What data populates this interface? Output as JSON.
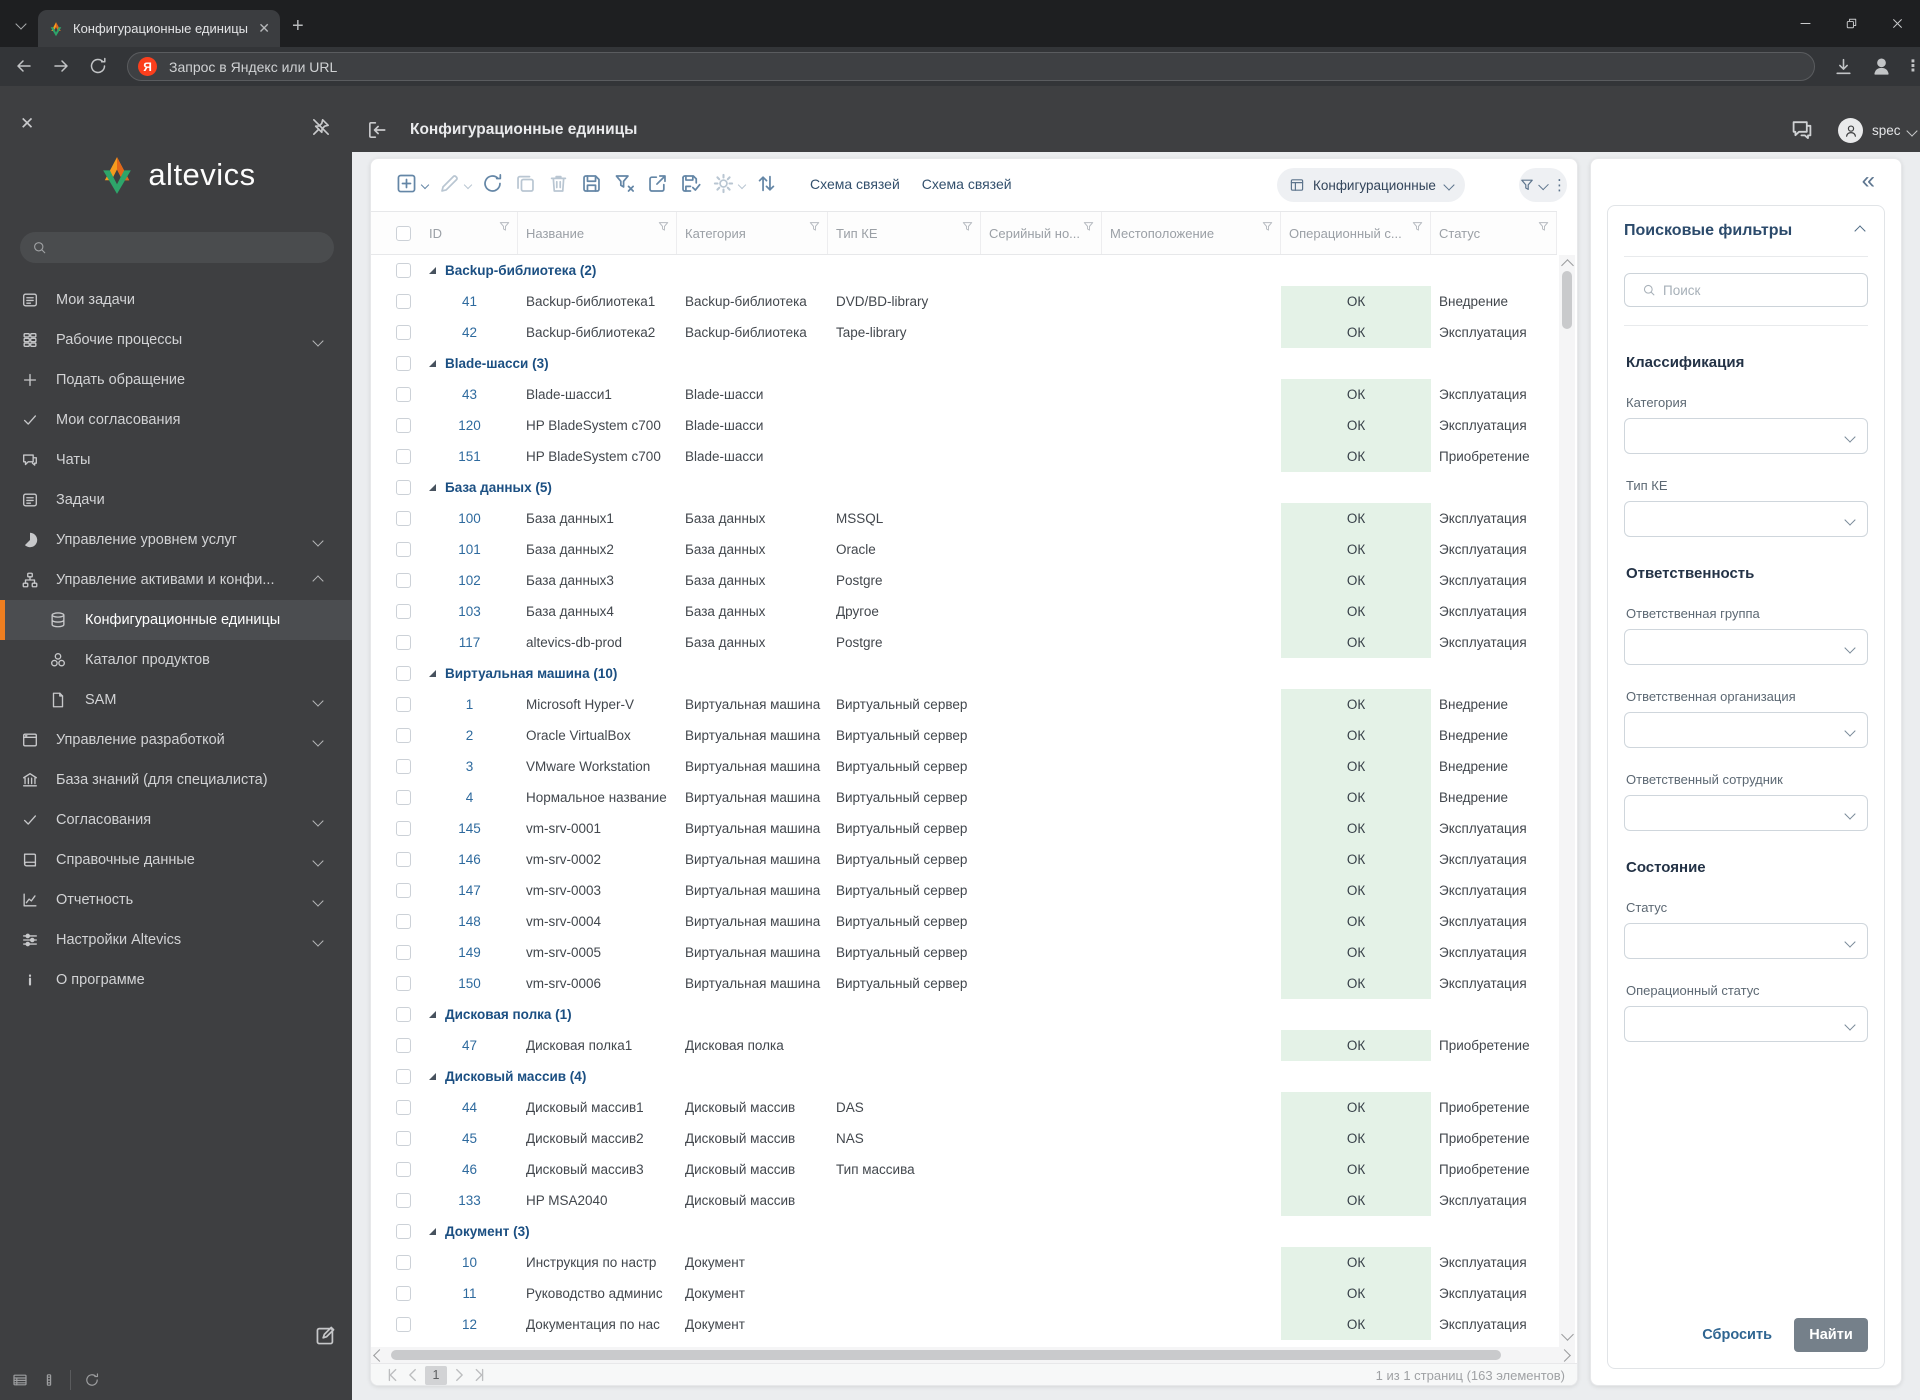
{
  "browser": {
    "tab_title": "Конфигурационные единицы",
    "url_placeholder": "Запрос в Яндекс или URL",
    "yandex_letter": "Я"
  },
  "app_header": {
    "title": "Конфигурационные единицы",
    "user": "spec"
  },
  "sidebar": {
    "logo_text": "altevics",
    "items": [
      {
        "label": "Мои задачи",
        "icon": "tasks-icon"
      },
      {
        "label": "Рабочие процессы",
        "icon": "processes-icon",
        "chevron": "down"
      },
      {
        "label": "Подать обращение",
        "icon": "plus-icon"
      },
      {
        "label": "Мои согласования",
        "icon": "check-icon"
      },
      {
        "label": "Чаты",
        "icon": "chat-icon"
      },
      {
        "label": "Задачи",
        "icon": "tasks-icon"
      },
      {
        "label": "Управление уровнем услуг",
        "icon": "pie-icon",
        "chevron": "down"
      },
      {
        "label": "Управление активами и конфи...",
        "icon": "hierarchy-icon",
        "chevron": "up"
      },
      {
        "label": "Конфигурационные единицы",
        "icon": "database-icon",
        "child": true,
        "active": true
      },
      {
        "label": "Каталог продуктов",
        "icon": "products-icon",
        "child": true
      },
      {
        "label": "SAM",
        "icon": "document-icon",
        "child": true,
        "chevron": "down"
      },
      {
        "label": "Управление разработкой",
        "icon": "window-icon",
        "chevron": "down"
      },
      {
        "label": "База знаний (для специалиста)",
        "icon": "bank-icon"
      },
      {
        "label": "Согласования",
        "icon": "check-icon",
        "chevron": "down"
      },
      {
        "label": "Справочные данные",
        "icon": "book-icon",
        "chevron": "down"
      },
      {
        "label": "Отчетность",
        "icon": "report-icon",
        "chevron": "down"
      },
      {
        "label": "Настройки Altevics",
        "icon": "sliders-icon",
        "chevron": "down"
      },
      {
        "label": "О программе",
        "icon": "info-icon"
      }
    ]
  },
  "toolbar": {
    "buttons": [
      {
        "name": "add-button",
        "icon": "plus-square-icon",
        "chevron": true
      },
      {
        "name": "edit-button",
        "icon": "pencil-icon",
        "chevron": true,
        "disabled": true
      },
      {
        "name": "refresh-button",
        "icon": "refresh-icon"
      },
      {
        "name": "copy-button",
        "icon": "copy-icon",
        "disabled": true
      },
      {
        "name": "delete-button",
        "icon": "trash-icon",
        "disabled": true
      },
      {
        "name": "save-button",
        "icon": "save-icon"
      },
      {
        "name": "clear-filter-button",
        "icon": "funnel-x-icon"
      },
      {
        "name": "export-button",
        "icon": "export-icon"
      },
      {
        "name": "save-view-button",
        "icon": "save-check-icon"
      },
      {
        "name": "settings-button",
        "icon": "gear-icon",
        "chevron": true,
        "disabled": true
      },
      {
        "name": "sort-button",
        "icon": "sort-icon"
      }
    ],
    "schema_link_1": "Схема связей",
    "schema_link_2": "Схема связей",
    "view_selector_label": "Конфигурационные..."
  },
  "table": {
    "columns": [
      "ID",
      "Название",
      "Категория",
      "Тип КЕ",
      "Серийный но...",
      "Местоположение",
      "Операционный с...",
      "Статус"
    ],
    "groups": [
      {
        "label": "Backup-библиотека (2)",
        "rows": [
          {
            "id": "41",
            "name": "Backup-библиотека1",
            "category": "Backup-библиотека",
            "type": "DVD/BD-library",
            "serial": "",
            "location": "",
            "op_status": "ОК",
            "status": "Внедрение"
          },
          {
            "id": "42",
            "name": "Backup-библиотека2",
            "category": "Backup-библиотека",
            "type": "Tape-library",
            "serial": "",
            "location": "",
            "op_status": "ОК",
            "status": "Эксплуатация"
          }
        ]
      },
      {
        "label": "Blade-шасси (3)",
        "rows": [
          {
            "id": "43",
            "name": "Blade-шасси1",
            "category": "Blade-шасси",
            "type": "",
            "serial": "",
            "location": "",
            "op_status": "ОК",
            "status": "Эксплуатация"
          },
          {
            "id": "120",
            "name": "HP BladeSystem c700",
            "category": "Blade-шасси",
            "type": "",
            "serial": "",
            "location": "",
            "op_status": "ОК",
            "status": "Эксплуатация"
          },
          {
            "id": "151",
            "name": "HP BladeSystem c700",
            "category": "Blade-шасси",
            "type": "",
            "serial": "",
            "location": "",
            "op_status": "ОК",
            "status": "Приобретение"
          }
        ]
      },
      {
        "label": "База данных (5)",
        "rows": [
          {
            "id": "100",
            "name": "База данных1",
            "category": "База данных",
            "type": "MSSQL",
            "serial": "",
            "location": "",
            "op_status": "ОК",
            "status": "Эксплуатация"
          },
          {
            "id": "101",
            "name": "База данных2",
            "category": "База данных",
            "type": "Oracle",
            "serial": "",
            "location": "",
            "op_status": "ОК",
            "status": "Эксплуатация"
          },
          {
            "id": "102",
            "name": "База данных3",
            "category": "База данных",
            "type": "Postgre",
            "serial": "",
            "location": "",
            "op_status": "ОК",
            "status": "Эксплуатация"
          },
          {
            "id": "103",
            "name": "База данных4",
            "category": "База данных",
            "type": "Другое",
            "serial": "",
            "location": "",
            "op_status": "ОК",
            "status": "Эксплуатация"
          },
          {
            "id": "117",
            "name": "altevics-db-prod",
            "category": "База данных",
            "type": "Postgre",
            "serial": "",
            "location": "",
            "op_status": "ОК",
            "status": "Эксплуатация"
          }
        ]
      },
      {
        "label": "Виртуальная машина (10)",
        "rows": [
          {
            "id": "1",
            "name": "Microsoft Hyper-V",
            "category": "Виртуальная машина",
            "type": "Виртуальный сервер",
            "serial": "",
            "location": "",
            "op_status": "ОК",
            "status": "Внедрение"
          },
          {
            "id": "2",
            "name": "Oracle VirtualBox",
            "category": "Виртуальная машина",
            "type": "Виртуальный сервер",
            "serial": "",
            "location": "",
            "op_status": "ОК",
            "status": "Внедрение"
          },
          {
            "id": "3",
            "name": "VMware Workstation",
            "category": "Виртуальная машина",
            "type": "Виртуальный сервер",
            "serial": "",
            "location": "",
            "op_status": "ОК",
            "status": "Внедрение"
          },
          {
            "id": "4",
            "name": "Нормальное название",
            "category": "Виртуальная машина",
            "type": "Виртуальный сервер",
            "serial": "",
            "location": "",
            "op_status": "ОК",
            "status": "Внедрение"
          },
          {
            "id": "145",
            "name": "vm-srv-0001",
            "category": "Виртуальная машина",
            "type": "Виртуальный сервер",
            "serial": "",
            "location": "",
            "op_status": "ОК",
            "status": "Эксплуатация"
          },
          {
            "id": "146",
            "name": "vm-srv-0002",
            "category": "Виртуальная машина",
            "type": "Виртуальный сервер",
            "serial": "",
            "location": "",
            "op_status": "ОК",
            "status": "Эксплуатация"
          },
          {
            "id": "147",
            "name": "vm-srv-0003",
            "category": "Виртуальная машина",
            "type": "Виртуальный сервер",
            "serial": "",
            "location": "",
            "op_status": "ОК",
            "status": "Эксплуатация"
          },
          {
            "id": "148",
            "name": "vm-srv-0004",
            "category": "Виртуальная машина",
            "type": "Виртуальный сервер",
            "serial": "",
            "location": "",
            "op_status": "ОК",
            "status": "Эксплуатация"
          },
          {
            "id": "149",
            "name": "vm-srv-0005",
            "category": "Виртуальная машина",
            "type": "Виртуальный сервер",
            "serial": "",
            "location": "",
            "op_status": "ОК",
            "status": "Эксплуатация"
          },
          {
            "id": "150",
            "name": "vm-srv-0006",
            "category": "Виртуальная машина",
            "type": "Виртуальный сервер",
            "serial": "",
            "location": "",
            "op_status": "ОК",
            "status": "Эксплуатация"
          }
        ]
      },
      {
        "label": "Дисковая полка (1)",
        "rows": [
          {
            "id": "47",
            "name": "Дисковая полка1",
            "category": "Дисковая полка",
            "type": "",
            "serial": "",
            "location": "",
            "op_status": "ОК",
            "status": "Приобретение"
          }
        ]
      },
      {
        "label": "Дисковый массив (4)",
        "rows": [
          {
            "id": "44",
            "name": "Дисковый массив1",
            "category": "Дисковый массив",
            "type": "DAS",
            "serial": "",
            "location": "",
            "op_status": "ОК",
            "status": "Приобретение"
          },
          {
            "id": "45",
            "name": "Дисковый массив2",
            "category": "Дисковый массив",
            "type": "NAS",
            "serial": "",
            "location": "",
            "op_status": "ОК",
            "status": "Приобретение"
          },
          {
            "id": "46",
            "name": "Дисковый массив3",
            "category": "Дисковый массив",
            "type": "Тип массива",
            "serial": "",
            "location": "",
            "op_status": "ОК",
            "status": "Приобретение"
          },
          {
            "id": "133",
            "name": "HP MSA2040",
            "category": "Дисковый массив",
            "type": "",
            "serial": "",
            "location": "",
            "op_status": "ОК",
            "status": "Эксплуатация"
          }
        ]
      },
      {
        "label": "Документ (3)",
        "rows": [
          {
            "id": "10",
            "name": "Инструкция по настр",
            "category": "Документ",
            "type": "",
            "serial": "",
            "location": "",
            "op_status": "ОК",
            "status": "Эксплуатация"
          },
          {
            "id": "11",
            "name": "Руководство админис",
            "category": "Документ",
            "type": "",
            "serial": "",
            "location": "",
            "op_status": "ОК",
            "status": "Эксплуатация"
          },
          {
            "id": "12",
            "name": "Документация по нас",
            "category": "Документ",
            "type": "",
            "serial": "",
            "location": "",
            "op_status": "ОК",
            "status": "Эксплуатация"
          }
        ]
      }
    ],
    "has_partial_row": true
  },
  "pagination": {
    "current_page": "1",
    "summary": "1 из 1 страниц (163 элементов)"
  },
  "filter_panel": {
    "title": "Поисковые фильтры",
    "search_placeholder": "Поиск",
    "sections": [
      {
        "title": "Классификация",
        "fields": [
          {
            "label": "Категория",
            "value": ""
          },
          {
            "label": "Тип КЕ",
            "value": ""
          }
        ]
      },
      {
        "title": "Ответственность",
        "fields": [
          {
            "label": "Ответственная группа",
            "value": ""
          },
          {
            "label": "Ответственная организация",
            "value": ""
          },
          {
            "label": "Ответственный сотрудник",
            "value": ""
          }
        ]
      },
      {
        "title": "Состояние",
        "fields": [
          {
            "label": "Статус",
            "value": ""
          },
          {
            "label": "Операционный статус",
            "value": ""
          }
        ]
      }
    ],
    "reset_label": "Сбросить",
    "find_label": "Найти"
  },
  "colors": {
    "accent_orange": "#ee7e20",
    "ok_cell_bg": "#e4f2e7",
    "link_blue": "#2e6a9e",
    "group_blue": "#1b4f82",
    "find_button_bg": "#75808a",
    "sidebar_bg": "#3e3f41",
    "yandex_red": "#fc3f1d"
  }
}
